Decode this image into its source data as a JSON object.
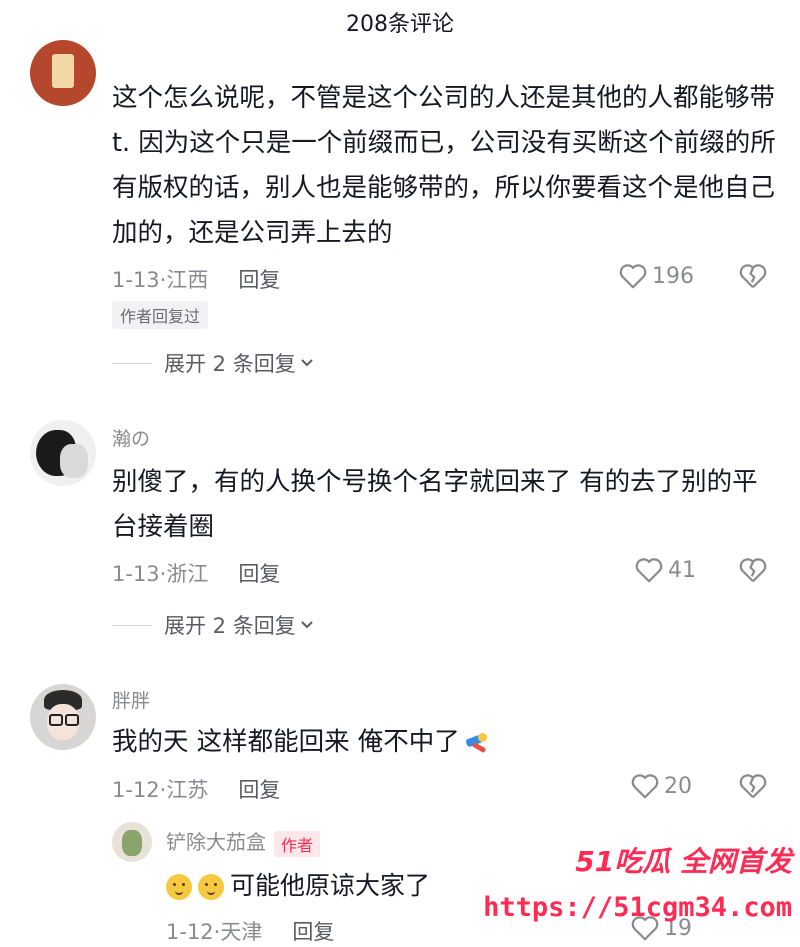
{
  "header": {
    "title": "208条评论"
  },
  "comments": [
    {
      "username": "",
      "text": "这个怎么说呢，不管是这个公司的人还是其他的人都能够带t. 因为这个只是一个前缀而已，公司没有买断这个前缀的所有版权的话，别人也是能够带的，所以你要看这个是他自己加的，还是公司弄上去的",
      "date_location": "1-13·江西",
      "reply_label": "回复",
      "likes": "196",
      "badge": "作者回复过",
      "expand_label": "展开 2 条回复"
    },
    {
      "username": "瀚の",
      "text": "别傻了，有的人换个号换个名字就回来了 有的去了别的平台接着圈",
      "date_location": "1-13·浙江",
      "reply_label": "回复",
      "likes": "41",
      "expand_label": "展开 2 条回复"
    },
    {
      "username": "胖胖",
      "text": "我的天 这样都能回来 俺不中了",
      "date_location": "1-12·江苏",
      "reply_label": "回复",
      "likes": "20"
    }
  ],
  "reply": {
    "username": "铲除大茄盒",
    "author_tag": "作者",
    "text": "可能他原谅大家了",
    "date_location": "1-12·天津",
    "reply_label": "回复",
    "likes": "19"
  },
  "watermark": {
    "top": "51吃瓜 全网首发",
    "bottom": "https://51cgm34.com"
  },
  "icons": {
    "like": "heart-outline-icon",
    "dislike": "broken-heart-icon",
    "expand": "chevron-down-icon"
  }
}
